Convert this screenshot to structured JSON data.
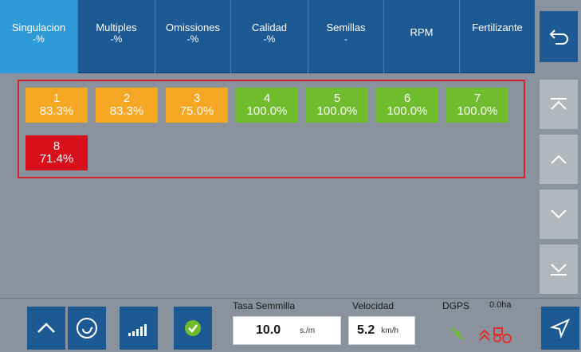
{
  "tabs": [
    {
      "label": "Singulacion",
      "sub": "-%",
      "active": true
    },
    {
      "label": "Multiples",
      "sub": "-%"
    },
    {
      "label": "Omissiones",
      "sub": "-%"
    },
    {
      "label": "Calidad",
      "sub": "-%"
    },
    {
      "label": "Semillas",
      "sub": "-"
    },
    {
      "label": "RPM",
      "sub": ""
    },
    {
      "label": "Fertilizante",
      "sub": ""
    }
  ],
  "rows": [
    {
      "num": "1",
      "value": "83.3%",
      "status": "orange"
    },
    {
      "num": "2",
      "value": "83.3%",
      "status": "orange"
    },
    {
      "num": "3",
      "value": "75.0%",
      "status": "orange"
    },
    {
      "num": "4",
      "value": "100.0%",
      "status": "green"
    },
    {
      "num": "5",
      "value": "100.0%",
      "status": "green"
    },
    {
      "num": "6",
      "value": "100.0%",
      "status": "green"
    },
    {
      "num": "7",
      "value": "100.0%",
      "status": "green"
    },
    {
      "num": "8",
      "value": "71.4%",
      "status": "red"
    }
  ],
  "bottom": {
    "tasa_label": "Tasa Semmilla",
    "tasa_value": "10.0",
    "tasa_unit": "s./m",
    "vel_label": "Velocidad",
    "vel_value": "5.2",
    "vel_unit": "km/h",
    "dgps_label": "DGPS",
    "area": "0.0ha"
  },
  "colors": {
    "tab_bg": "#1d5a94",
    "tab_active": "#2f9ad8",
    "orange": "#f5a623",
    "green": "#6fbd2c",
    "red": "#d90f1c",
    "frame": "#d0262e"
  },
  "icons": {
    "back": "return-arrow-icon",
    "scroll_top": "double-up-icon",
    "scroll_up": "chevron-up-icon",
    "scroll_down": "chevron-down-icon",
    "scroll_bottom": "double-down-icon",
    "expand": "chevron-up-icon",
    "refresh": "refresh-icon",
    "rate": "rate-bars-icon",
    "status_ok": "check-circle-icon",
    "gps": "satellite-icon",
    "tractor": "tractor-icon",
    "send": "send-arrow-icon"
  }
}
